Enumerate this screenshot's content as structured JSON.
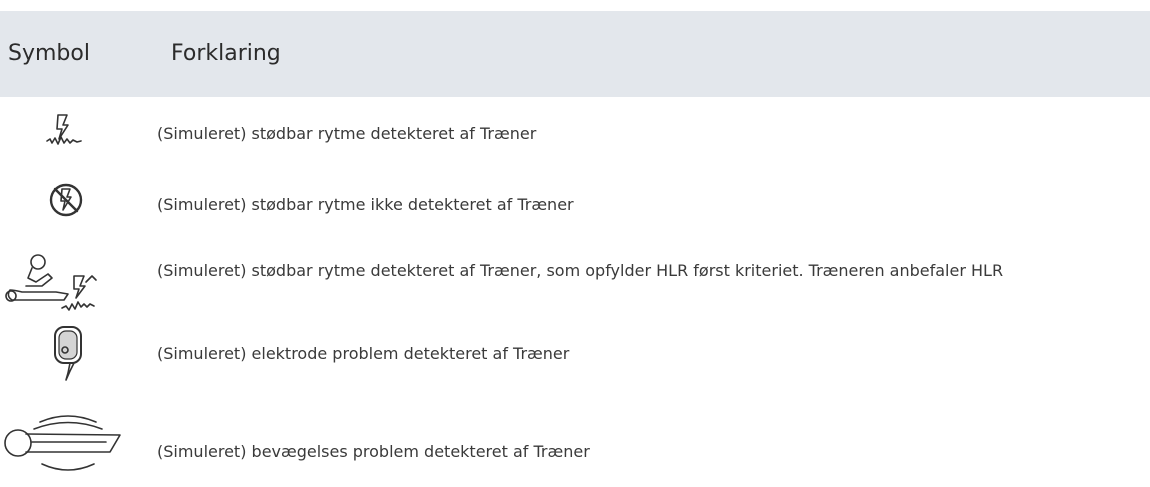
{
  "table": {
    "header": {
      "symbol": "Symbol",
      "explanation": "Forklaring"
    },
    "rows": [
      {
        "icon": "shockable-rhythm-icon",
        "text": "(Simuleret) stødbar rytme detekteret af Træner"
      },
      {
        "icon": "no-shock-icon",
        "text": "(Simuleret) stødbar rytme ikke detekteret af Træner"
      },
      {
        "icon": "cpr-first-shock-icon",
        "text": "(Simuleret) stødbar rytme detekteret af Træner, som opfylder HLR først kriteriet. Træneren anbefaler HLR"
      },
      {
        "icon": "electrode-pad-icon",
        "text": "(Simuleret) elektrode problem detekteret af Træner"
      },
      {
        "icon": "patient-motion-icon",
        "text": "(Simuleret) bevægelses problem detekteret af Træner"
      }
    ]
  }
}
